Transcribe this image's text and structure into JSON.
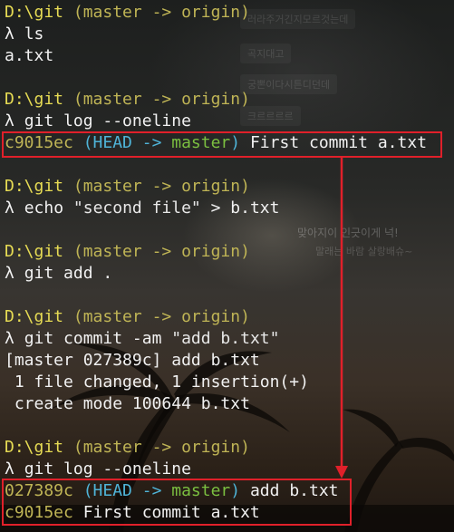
{
  "terminal": {
    "block1": {
      "prompt_path": "D:\\git",
      "prompt_branch": "(master -> origin)",
      "lambda": "λ",
      "command": "ls",
      "output": "a.txt"
    },
    "block2": {
      "prompt_path": "D:\\git",
      "prompt_branch": "(master -> origin)",
      "lambda": "λ",
      "command": "git log --oneline",
      "log_hash": "c9015ec",
      "log_refs_open": "(",
      "log_head": "HEAD ->",
      "log_branch": "master",
      "log_refs_close": ")",
      "log_message": "First commit a.txt"
    },
    "block3": {
      "prompt_path": "D:\\git",
      "prompt_branch": "(master -> origin)",
      "lambda": "λ",
      "command_main": "echo",
      "command_string": "\"second file\"",
      "command_rest": "> b.txt"
    },
    "block4": {
      "prompt_path": "D:\\git",
      "prompt_branch": "(master -> origin)",
      "lambda": "λ",
      "command": "git add ."
    },
    "block5": {
      "prompt_path": "D:\\git",
      "prompt_branch": "(master -> origin)",
      "lambda": "λ",
      "command_main": "git commit -am",
      "command_string": "\"add b.txt\"",
      "output1": "[master 027389c] add b.txt",
      "output2": " 1 file changed, 1 insertion(+)",
      "output3": " create mode 100644 b.txt"
    },
    "block6": {
      "prompt_path": "D:\\git",
      "prompt_branch": "(master -> origin)",
      "lambda": "λ",
      "command": "git log --oneline",
      "log1_hash": "027389c",
      "log1_refs_open": "(",
      "log1_head": "HEAD ->",
      "log1_branch": "master",
      "log1_refs_close": ")",
      "log1_message": "add b.txt",
      "log2_hash": "c9015ec",
      "log2_message": "First commit a.txt"
    }
  },
  "background": {
    "faded_labels": [
      "러라주거긴지모르것는데",
      "곡지대고",
      "궁뽄이다시튼디던데",
      "크르르르르",
      "맞아지이 인긋이게 넉!",
      "말래는 바람 살랑배슈~"
    ]
  },
  "colors": {
    "prompt_path": "#e6db54",
    "prompt_branch": "#bfb455",
    "head_ref": "#4fb4d8",
    "branch_ref": "#7bbf40",
    "text": "#f1f1f1",
    "highlight_box": "#e0202a"
  }
}
